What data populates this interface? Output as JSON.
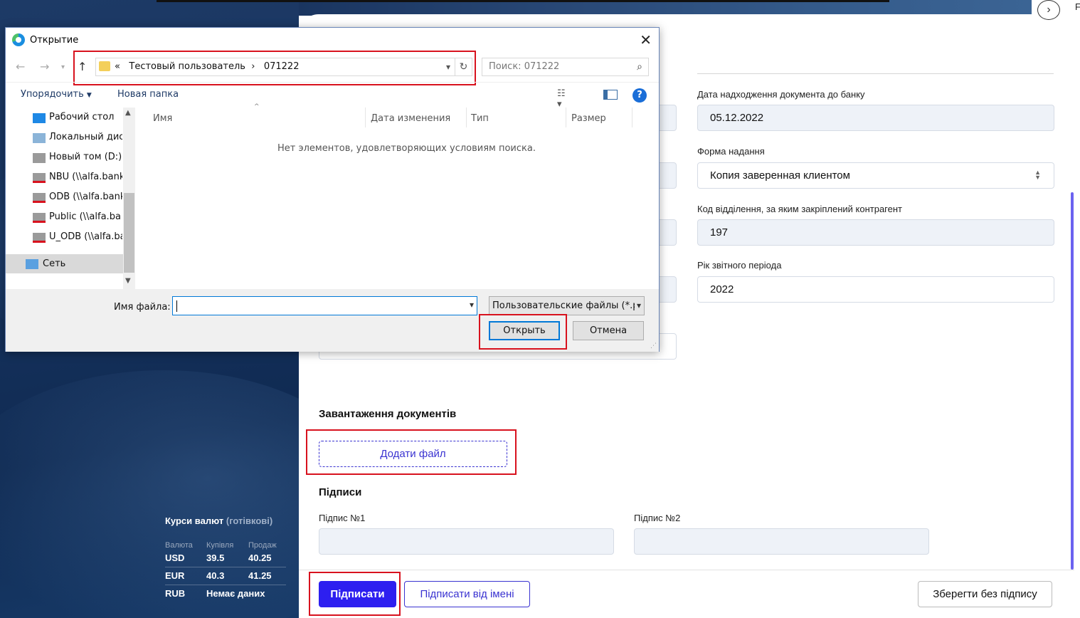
{
  "app": {
    "form": {
      "date_label": "Дата надходження документа до банку",
      "date_value": "05.12.2022",
      "form_label": "Форма надання",
      "form_value": "Копия заверенная клиентом",
      "branch_label": "Код відділення, за яким закріплений контрагент",
      "branch_value": "197",
      "year_label": "Рік звітного періода",
      "year_value": "2022"
    },
    "uploads": {
      "title": "Завантаження документів",
      "add_file": "Додати файл"
    },
    "signatures": {
      "title": "Підписи",
      "sig1_label": "Підпис №1",
      "sig2_label": "Підпис №2"
    },
    "footer": {
      "sign": "Підписати",
      "sign_on_behalf": "Підписати від імені",
      "save_without_sign": "Зберегти без підпису"
    },
    "nav_next_icon": "chevron-right-icon",
    "edge_letter": "F"
  },
  "rates": {
    "title": "Курси валют",
    "subtitle": "(готівкові)",
    "headers": [
      "Валюта",
      "Купівля",
      "Продаж"
    ],
    "rows": [
      {
        "currency": "USD",
        "buy": "39.5",
        "sell": "40.25"
      },
      {
        "currency": "EUR",
        "buy": "40.3",
        "sell": "41.25"
      },
      {
        "currency": "RUB",
        "buy": "Немає даних",
        "sell": ""
      }
    ]
  },
  "dialog": {
    "title": "Открытие",
    "close": "✕",
    "breadcrumb_prefix": "«",
    "breadcrumb": [
      "Тестовый пользователь",
      "071222"
    ],
    "search_placeholder": "Поиск: 071222",
    "organize": "Упорядочить",
    "new_folder": "Новая папка",
    "help": "?",
    "nav_items": [
      {
        "label": "Рабочий стол",
        "icon": "desktop-icon"
      },
      {
        "label": "Локальный дис",
        "icon": "drive-icon"
      },
      {
        "label": "Новый том (D:)",
        "icon": "drive-icon"
      },
      {
        "label": "NBU (\\\\alfa.bank",
        "icon": "network-drive-icon"
      },
      {
        "label": "ODB (\\\\alfa.bank",
        "icon": "network-drive-icon"
      },
      {
        "label": "Public (\\\\alfa.ba",
        "icon": "network-drive-icon"
      },
      {
        "label": "U_ODB (\\\\alfa.ba",
        "icon": "network-drive-icon"
      }
    ],
    "network": "Сеть",
    "columns": [
      "Имя",
      "Дата изменения",
      "Тип",
      "Размер"
    ],
    "empty_message": "Нет элементов, удовлетворяющих условиям поиска.",
    "filename_label": "Имя файла:",
    "filename_value": "",
    "filter": "Пользовательские файлы (*.p",
    "open": "Открыть",
    "cancel": "Отмена"
  },
  "colors": {
    "accent": "#2d1ff0",
    "highlight": "#d8121e",
    "sidebar_bg": "#17335e"
  }
}
